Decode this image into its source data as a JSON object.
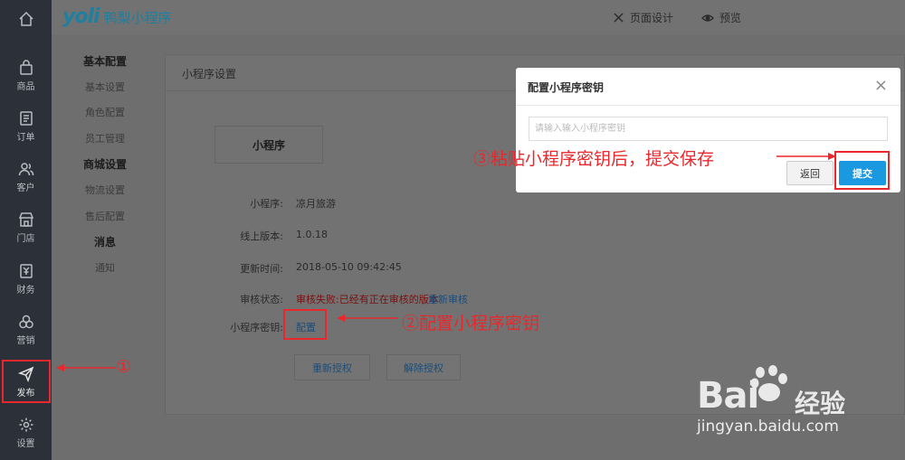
{
  "brand": {
    "logo_mark": "yoli",
    "name": "鸭梨小程序"
  },
  "topnav": {
    "page_design": "页面设计",
    "preview": "预览"
  },
  "sidebar": {
    "items": [
      {
        "label": "商品",
        "icon": "bag-icon"
      },
      {
        "label": "订单",
        "icon": "document-icon"
      },
      {
        "label": "客户",
        "icon": "users-icon"
      },
      {
        "label": "门店",
        "icon": "store-icon"
      },
      {
        "label": "财务",
        "icon": "ledger-icon"
      },
      {
        "label": "营销",
        "icon": "rings-icon"
      },
      {
        "label": "发布",
        "icon": "send-icon"
      },
      {
        "label": "设置",
        "icon": "gear-icon"
      }
    ]
  },
  "submenu": {
    "group_basic": "基本配置",
    "basic_settings": "基本设置",
    "role_config": "角色配置",
    "staff_manage": "员工管理",
    "group_mall": "商城设置",
    "logistics": "物流设置",
    "after_sales": "售后配置",
    "group_message": "消息",
    "notice": "通知"
  },
  "main": {
    "card_title": "小程序设置",
    "mp_box": "小程序",
    "fields": {
      "mp_label": "小程序:",
      "mp_value": "凉月旅游",
      "version_label": "线上版本:",
      "version_value": "1.0.18",
      "update_label": "更新时间:",
      "update_value": "2018-05-10 09:42:45",
      "audit_label": "审核状态:",
      "audit_value": "审核失败:已经有正在审核的版本",
      "audit_link": "重新审核",
      "secret_label": "小程序密钥:",
      "secret_link": "配置"
    },
    "btn_reauth": "重新授权",
    "btn_unbind": "解除授权"
  },
  "modal": {
    "title": "配置小程序密钥",
    "input_placeholder": "请输入输入小程序密钥",
    "input_value": "",
    "btn_back": "返回",
    "btn_submit": "提交"
  },
  "annotations": {
    "step1": "①",
    "step2": "②配置小程序密钥",
    "step3": "③粘贴小程序密钥后，提交保存"
  },
  "watermark": {
    "main": "Bai",
    "sub": "经验",
    "url": "jingyan.baidu.com"
  },
  "colors": {
    "annotation_red": "#e8282c",
    "primary_blue": "#1a99e0",
    "sidebar_bg": "#2c3038"
  }
}
